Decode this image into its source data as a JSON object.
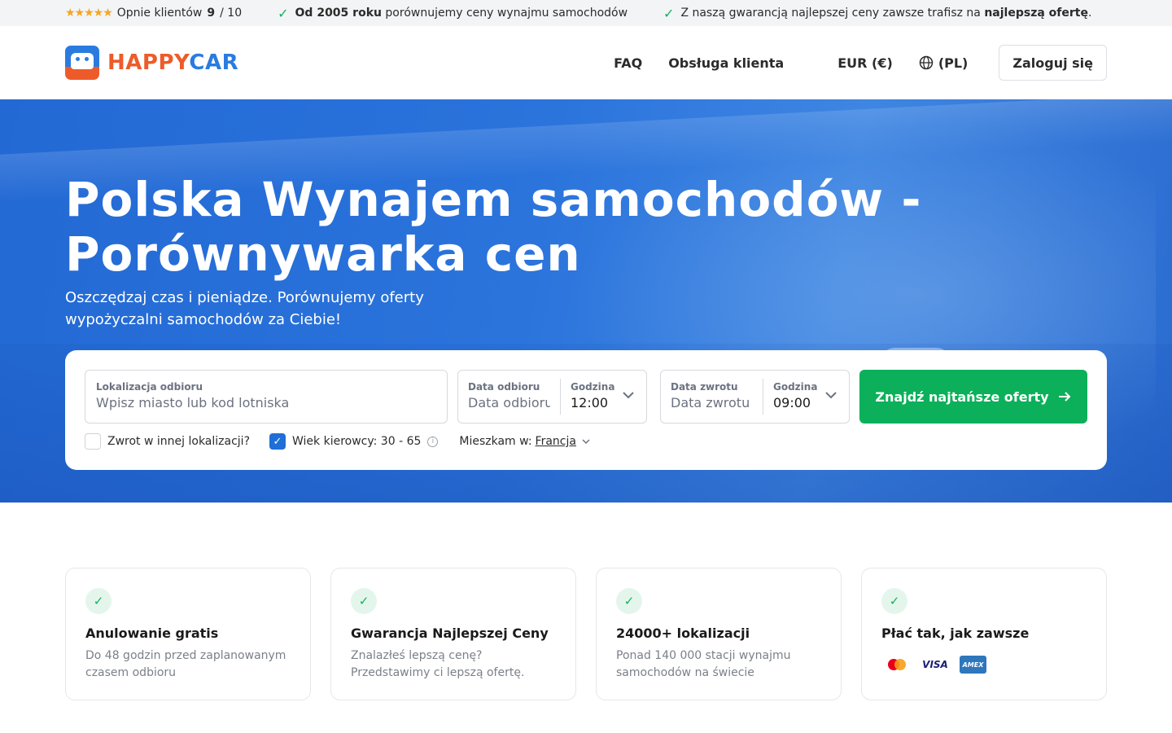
{
  "topbar": {
    "stars_icon": "star-icon",
    "rating_label": "Opnie klientów",
    "rating_value": "9",
    "rating_sep": "/ 10",
    "usp1_bold": "Od 2005 roku",
    "usp1_rest": "porównujemy ceny wynajmu samochodów",
    "usp2_start": "Z naszą gwarancją najlepszej ceny zawsze trafisz na",
    "usp2_bold": "najlepszą ofertę",
    "usp2_end": "."
  },
  "header": {
    "logo_a": "HAPPY",
    "logo_b": "CAR",
    "nav": {
      "faq": "FAQ",
      "support": "Obsługa klienta",
      "currency": "EUR (€)",
      "language": "(PL)"
    },
    "login": "Zaloguj się"
  },
  "hero": {
    "title": "Polska Wynajem samochodów - Porównywarka cen",
    "subtitle": "Oszczędzaj czas i pieniądze. Porównujemy oferty wypożyczalni samochodów za Ciebie!"
  },
  "search": {
    "location_label": "Lokalizacja odbioru",
    "location_placeholder": "Wpisz miasto lub kod lotniska",
    "pickup_date_label": "Data odbioru",
    "pickup_date_placeholder": "Data odbioru",
    "pickup_time_label": "Godzina",
    "pickup_time_value": "12:00",
    "return_date_label": "Data zwrotu",
    "return_date_placeholder": "Data zwrotu",
    "return_time_label": "Godzina",
    "return_time_value": "09:00",
    "cta": "Znajdź najtańsze oferty",
    "opt_other_location": "Zwrot w innej lokalizacji?",
    "opt_other_location_checked": false,
    "opt_driver_age": "Wiek kierowcy: 30 - 65",
    "opt_driver_age_checked": true,
    "residence_label": "Mieszkam w:",
    "residence_value": "Francja"
  },
  "features": [
    {
      "title": "Anulowanie gratis",
      "text": "Do 48 godzin przed zaplanowanym czasem odbioru"
    },
    {
      "title": "Gwarancja Najlepszej Ceny",
      "text": "Znalazłeś lepszą cenę? Przedstawimy ci lepszą ofertę."
    },
    {
      "title": "24000+ lokalizacji",
      "text": "Ponad 140 000 stacji wynajmu samochodów na świecie"
    },
    {
      "title": "Płać tak, jak zawsze",
      "payment": {
        "visa": "VISA",
        "amex": "AMEX"
      }
    }
  ],
  "colors": {
    "brand_blue": "#2a7be0",
    "brand_orange": "#ee5b2b",
    "cta_green": "#0cb05a"
  }
}
